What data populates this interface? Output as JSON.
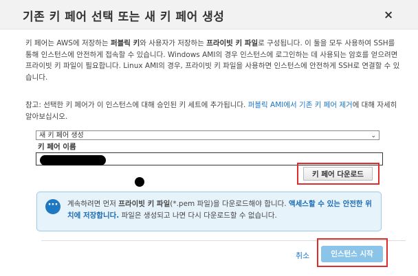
{
  "dialog": {
    "title": "기존 키 페어 선택 또는 새 키 페어 생성",
    "close_label": "×"
  },
  "description": {
    "p1": "키 페어는 AWS에 저장하는 ",
    "public_key": "퍼블릭 키",
    "p2": "와 사용자가 저장하는 ",
    "private_key_file": "프라이빗 키 파일",
    "p3": "로 구성됩니다. 이 둘을 모두 사용하여 SSH를 통해 인스턴스에 안전하게 접속할 수 있습니다. Windows AMI의 경우 인스턴스에 로그인하는 데 사용되는 암호를 얻으려면 프라이빗 키 파일이 필요합니다. Linux AMI의 경우, 프라이빗 키 파일을 사용하면 인스턴스에 안전하게 SSH로 연결할 수 있습니다."
  },
  "note": {
    "text": "참고: 선택한 키 페어가 이 인스턴스에 대해 승인된 키 세트에 추가됩니다. ",
    "link": "퍼블릭 AMI에서 기존 키 페어 제거",
    "suffix": "에 대해 자세히 알아보십시오."
  },
  "key_pair_select": {
    "selected": "새 키 페어 생성"
  },
  "key_pair_name": {
    "label": "키 페어 이름",
    "value": ""
  },
  "download_button": {
    "label": "키 페어 다운로드"
  },
  "info_box": {
    "t1": "계속하려면 먼저 ",
    "b1": "프라이빗 키 파일",
    "t2": "(*.pem 파일)을 다운로드해야 합니다. ",
    "b2": "액세스할 수 있는 안전한 위치에 저장합니다.",
    "t3": " 파일은 생성되고 나면 다시 다운로드할 수 없습니다.",
    "icon": "ellipsis-icon"
  },
  "footer": {
    "cancel_label": "취소",
    "launch_label": "인스턴스 시작"
  },
  "colors": {
    "header_bg": "#f2f2f2",
    "link": "#1a73c7",
    "highlight": "#e02b2b",
    "launch_bg": "#8ac4e8",
    "info_bg": "#e6f3fb"
  }
}
